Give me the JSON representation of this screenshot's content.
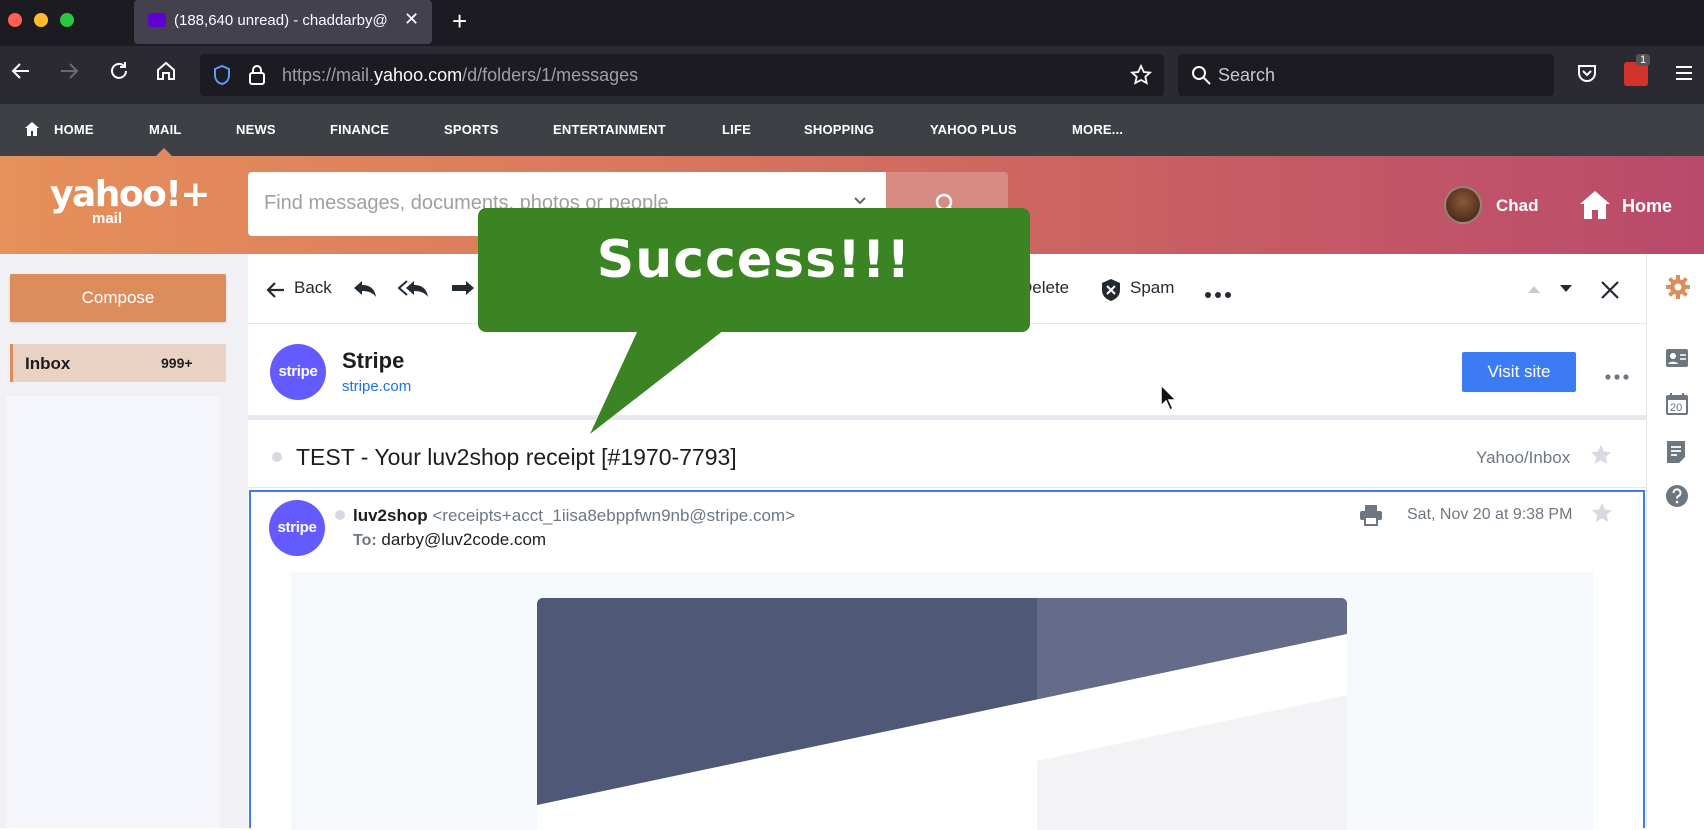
{
  "browser": {
    "tab_title": "(188,640 unread) - chaddarby@",
    "url_prefix": "https://mail.",
    "url_domain": "yahoo.com",
    "url_path": "/d/folders/1/messages",
    "search_label": "Search",
    "badge_count": "1"
  },
  "yahoo_nav": {
    "items": [
      "HOME",
      "MAIL",
      "NEWS",
      "FINANCE",
      "SPORTS",
      "ENTERTAINMENT",
      "LIFE",
      "SHOPPING",
      "YAHOO PLUS",
      "MORE..."
    ]
  },
  "header": {
    "logo": "yahoo!+",
    "logo_sub": "mail",
    "search_placeholder": "Find messages, documents, photos or people",
    "user_name": "Chad",
    "home_label": "Home"
  },
  "sidebar": {
    "compose_label": "Compose",
    "inbox_label": "Inbox",
    "inbox_count": "999+"
  },
  "toolbar": {
    "back_label": "Back",
    "delete_label": "Delete",
    "spam_label": "Spam"
  },
  "sender": {
    "logo_text": "stripe",
    "name": "Stripe",
    "domain": "stripe.com",
    "visit_label": "Visit site"
  },
  "message": {
    "subject": "TEST - Your luv2shop receipt [#1970-7793]",
    "folder": "Yahoo/Inbox",
    "from_name": "luv2shop",
    "from_address": "<receipts+acct_1iisa8ebppfwn9nb@stripe.com>",
    "to_label": "To:",
    "to_address": "darby@luv2code.com",
    "date": "Sat, Nov 20 at 9:38 PM"
  },
  "right_rail": {
    "calendar_day": "20"
  },
  "callout": {
    "text": "Success!!!",
    "color": "#3b8423"
  }
}
